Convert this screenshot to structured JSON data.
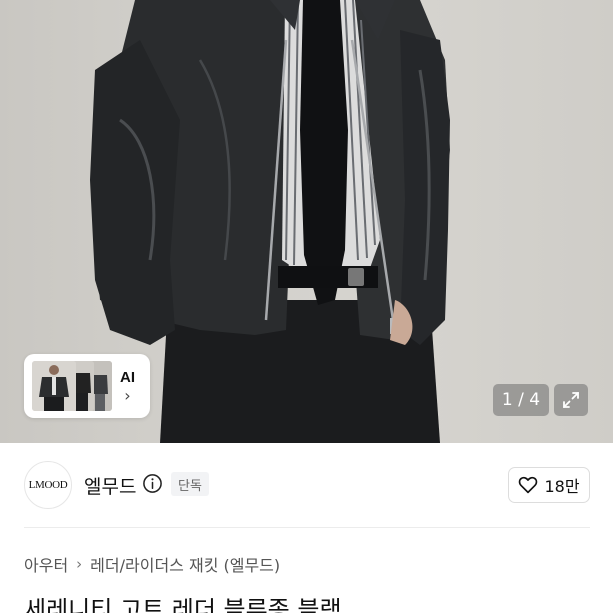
{
  "hero": {
    "ai_chip_label": "AI",
    "page_indicator": "1 / 4"
  },
  "shop": {
    "logo_text": "LMOOD",
    "name": "엘무드",
    "exclusive_badge": "단독",
    "like_count": "18만"
  },
  "breadcrumb": {
    "items": [
      "아우터",
      "레더/라이더스 재킷 (엘무드)"
    ]
  },
  "product": {
    "title": "세레니티 고트 레더 블루종 블랙"
  }
}
